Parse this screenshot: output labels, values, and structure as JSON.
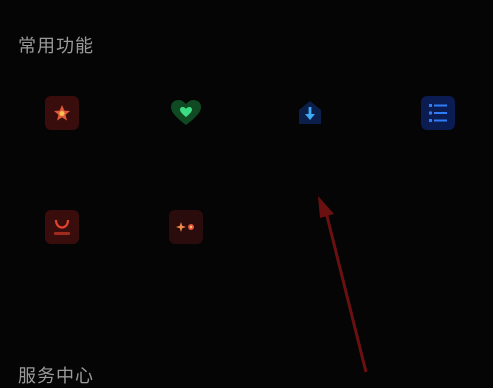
{
  "sections": {
    "common_title": "常用功能",
    "service_title": "服务中心"
  },
  "items": [
    {
      "label": "",
      "icon": "star-badge-icon",
      "color": "#c0392b"
    },
    {
      "label": "",
      "icon": "heart-icon",
      "color": "#2ecc71"
    },
    {
      "label": "",
      "icon": "download-arrow-icon",
      "color": "#2e86de"
    },
    {
      "label": "",
      "icon": "list-icon",
      "color": "#1e6fe0"
    },
    {
      "label": "",
      "icon": "bag-icon",
      "color": "#c0392b"
    },
    {
      "label": "",
      "icon": "sparkle-icon",
      "color": "#d35400"
    }
  ]
}
